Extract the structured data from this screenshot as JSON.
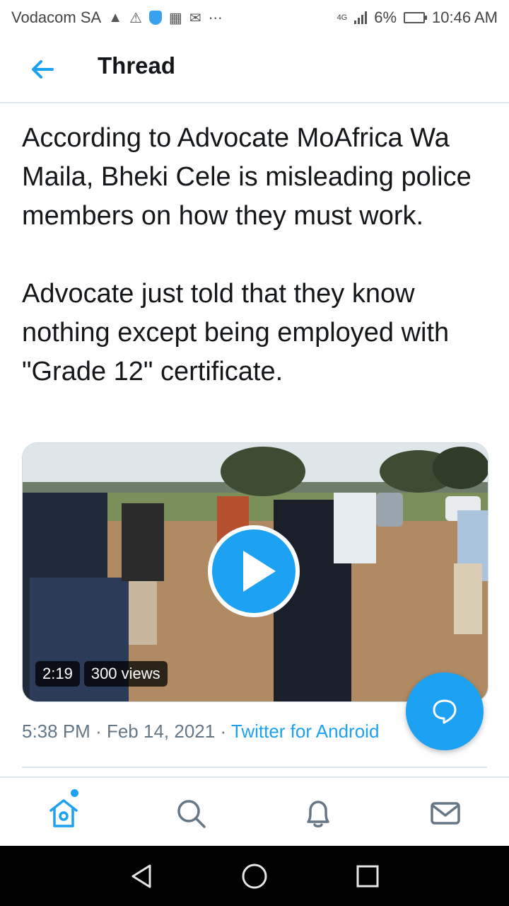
{
  "status_bar": {
    "carrier": "Vodacom SA",
    "network": "4G",
    "battery": "6%",
    "time": "10:46 AM"
  },
  "header": {
    "title": "Thread"
  },
  "tweet": {
    "text": "According to Advocate MoAfrica Wa Maila, Bheki Cele is misleading police members on how they must work.\n\nAdvocate just told that they know nothing except being employed with \"Grade 12\" certificate.",
    "video": {
      "duration": "2:19",
      "views": "300 views"
    },
    "time": "5:38 PM",
    "date": "Feb 14, 2021",
    "separator": "·",
    "source": "Twitter for Android"
  },
  "colors": {
    "accent": "#1da1f2",
    "text": "#14171a",
    "muted": "#657786",
    "border": "#e1e8ed"
  },
  "bottom_nav": {
    "items": [
      "home-icon",
      "search-icon",
      "notifications-icon",
      "messages-icon"
    ]
  },
  "system_nav": {
    "items": [
      "back-triangle-icon",
      "home-circle-icon",
      "recents-square-icon"
    ]
  }
}
